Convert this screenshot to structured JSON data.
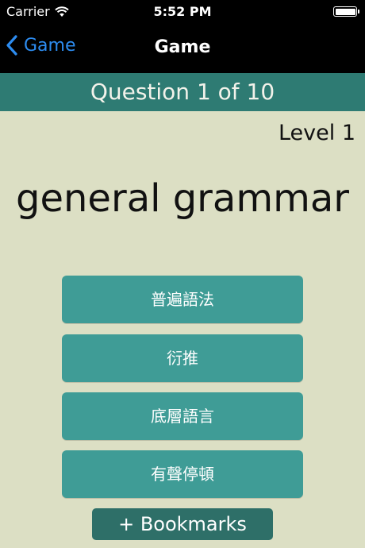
{
  "status_bar": {
    "carrier": "Carrier",
    "time": "5:52 PM",
    "wifi_icon": "wifi-icon",
    "battery_icon": "battery-icon"
  },
  "nav": {
    "back_label": "Game",
    "back_icon": "chevron-left-icon",
    "title": "Game",
    "back_color": "#2d8cf0"
  },
  "quiz": {
    "progress": "Question 1 of 10",
    "level": "Level 1",
    "term": "general grammar",
    "answers": [
      "普遍語法",
      "衍推",
      "底層語言",
      "有聲停頓"
    ],
    "bookmarks_label": "+ Bookmarks"
  },
  "colors": {
    "background": "#dcdfc4",
    "header": "#2e7b73",
    "answer_button": "#3f9c96",
    "bookmarks_button": "#2e6f68"
  }
}
